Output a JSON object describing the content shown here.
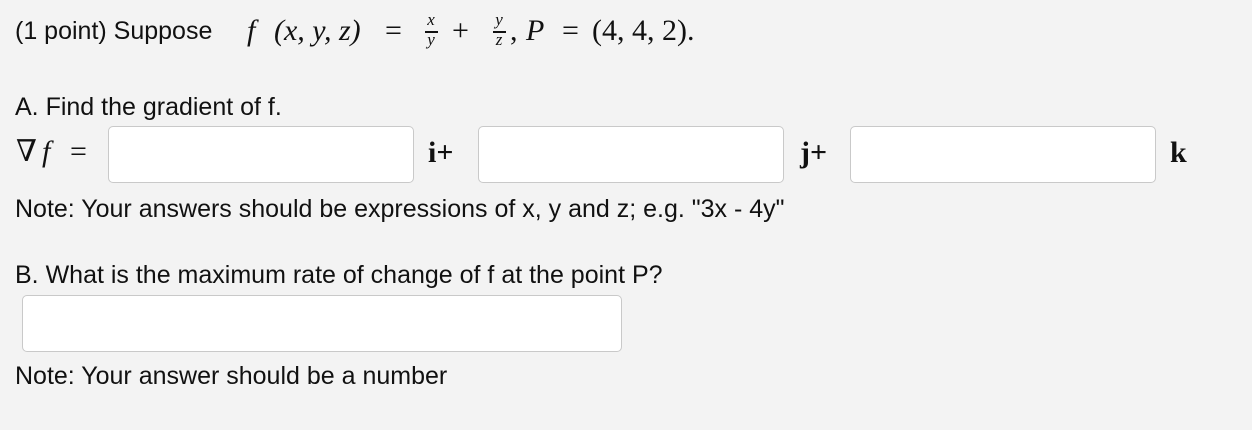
{
  "problem": {
    "prefix": "(1 point) Suppose ",
    "func_name": "f",
    "func_args": "(x, y, z)",
    "equals": "=",
    "frac1_num": "x",
    "frac1_den": "y",
    "plus": "+",
    "frac2_num": "y",
    "frac2_den": "z",
    "comma": ",",
    "point_name": "P",
    "point_equals": "=",
    "point_value": "(4, 4, 2)."
  },
  "part_a": {
    "heading": "A. Find the gradient of f.",
    "nabla": "∇",
    "grad_f": "f",
    "grad_equals": "=",
    "i_label": "i+",
    "j_label": "j+",
    "k_label": "k",
    "answer_i": "",
    "answer_j": "",
    "answer_k": "",
    "note": "Note: Your answers should be expressions of x, y and z; e.g. \"3x - 4y\""
  },
  "part_b": {
    "heading": "B. What is the maximum rate of change of f at the point P?",
    "answer": "",
    "note": "Note: Your answer should be a number"
  }
}
